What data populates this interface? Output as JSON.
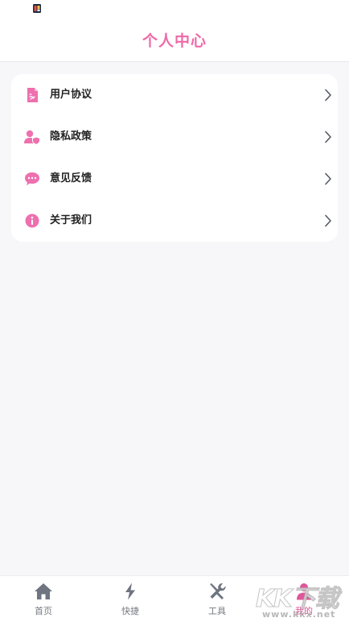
{
  "header": {
    "title": "个人中心"
  },
  "menu": {
    "items": [
      {
        "label": "用户协议",
        "icon": "document-icon"
      },
      {
        "label": "隐私政策",
        "icon": "user-shield-icon"
      },
      {
        "label": "意见反馈",
        "icon": "chat-bubble-icon"
      },
      {
        "label": "关于我们",
        "icon": "info-icon"
      }
    ]
  },
  "tabs": [
    {
      "label": "首页",
      "icon": "home-icon",
      "active": false
    },
    {
      "label": "快捷",
      "icon": "lightning-icon",
      "active": false
    },
    {
      "label": "工具",
      "icon": "tools-icon",
      "active": false
    },
    {
      "label": "我的",
      "icon": "person-icon",
      "active": true
    }
  ],
  "watermark": {
    "brand": "KK下载",
    "url": "www.kkx.net"
  },
  "colors": {
    "accent": "#ef6aa8",
    "icon_pink": "#ee70ae",
    "tab_inactive": "#6e7480",
    "background": "#f7f7fa"
  }
}
